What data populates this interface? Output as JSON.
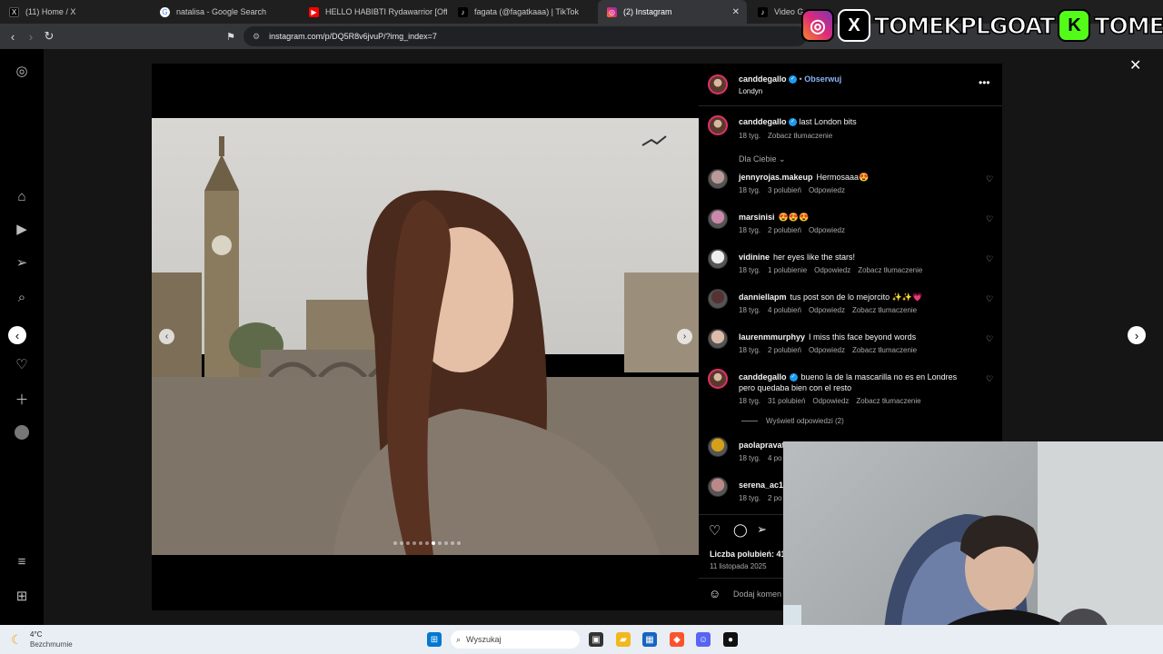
{
  "tabs": [
    {
      "title": "(11) Home / X",
      "icon": "x-logo-icon"
    },
    {
      "title": "natalisa - Google Search",
      "icon": "google-icon"
    },
    {
      "title": "HELLO HABIBTI Rydawarrior [Official",
      "icon": "youtube-icon"
    },
    {
      "title": "fagata (@fagatkaaa) | TikTok",
      "icon": "tiktok-icon"
    },
    {
      "title": "(2) Instagram",
      "icon": "instagram-icon",
      "active": true
    },
    {
      "title": "Video Gam",
      "icon": "tiktok-icon"
    }
  ],
  "address": {
    "url": "instagram.com/p/DQ5R8v6jvuP/?img_index=7"
  },
  "overlay": {
    "handle_x": "TOMEKPLGOAT",
    "handle_kick": "TOMEKPL",
    "kick_letter": "K"
  },
  "post": {
    "author": "canddegallo",
    "follow_label": "Obserwuj",
    "location": "Londyn",
    "caption": "last London bits",
    "caption_age": "18 tyg.",
    "translate_label": "Zobacz tłumaczenie",
    "for_you_label": "Dla Ciebie",
    "likes_label": "Liczba polubień: 41",
    "date": "11 listopada 2025",
    "add_comment_placeholder": "Dodaj komen",
    "carousel_total": 11,
    "carousel_index": 7
  },
  "comments": [
    {
      "user": "jennyrojas.makeup",
      "text": "Hermosaaa😍",
      "age": "18 tyg.",
      "likes": "3 polubień",
      "reply": "Odpowiedz",
      "translate": ""
    },
    {
      "user": "marsinisi",
      "text": "😍😍😍",
      "age": "18 tyg.",
      "likes": "2 polubień",
      "reply": "Odpowiedz",
      "translate": ""
    },
    {
      "user": "vidinine",
      "text": "her eyes like the stars!",
      "age": "18 tyg.",
      "likes": "1 polubienie",
      "reply": "Odpowiedz",
      "translate": "Zobacz tłumaczenie"
    },
    {
      "user": "danniellapm",
      "text": "tus post son de lo mejorcito ✨✨💗",
      "age": "18 tyg.",
      "likes": "4 polubień",
      "reply": "Odpowiedz",
      "translate": "Zobacz tłumaczenie"
    },
    {
      "user": "laurenmmurphyy",
      "text": "I miss this face beyond words",
      "age": "18 tyg.",
      "likes": "2 polubień",
      "reply": "Odpowiedz",
      "translate": "Zobacz tłumaczenie"
    },
    {
      "user": "canddegallo",
      "text": "bueno la de la mascarilla no es en Londres pero quedaba bien con el resto",
      "age": "18 tyg.",
      "likes": "31 polubień",
      "reply": "Odpowiedz",
      "translate": "Zobacz tłumaczenie"
    },
    {
      "user": "paolapravat",
      "text": "",
      "age": "18 tyg.",
      "likes": "4 po",
      "reply": "",
      "translate": ""
    },
    {
      "user": "serena_ac14",
      "text": "",
      "age": "18 tyg.",
      "likes": "2 po",
      "reply": "",
      "translate": ""
    }
  ],
  "view_replies": "Wyświetl odpowiedzi (2)",
  "weather": {
    "temp": "4°C",
    "condition": "Bezchmurnie"
  },
  "taskbar": {
    "search_placeholder": "Wyszukaj"
  },
  "colors": {
    "instagram_link": "#8ab4f8",
    "verified": "#1d9bf0",
    "kick_green": "#53fc18"
  }
}
